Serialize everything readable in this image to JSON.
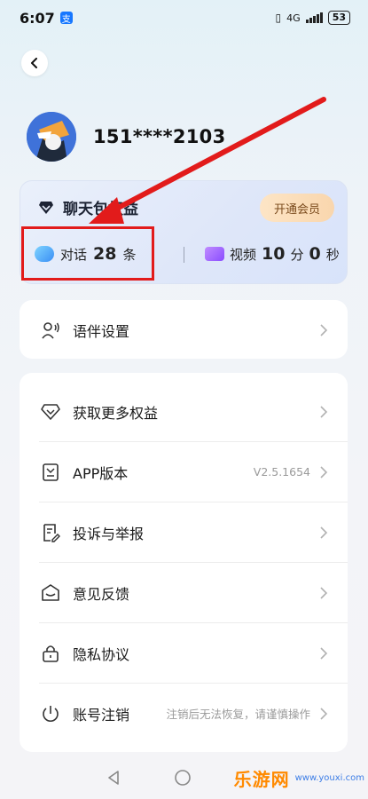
{
  "status_bar": {
    "time": "6:07",
    "app_badge_icon": "alipay-icon",
    "network": "4G",
    "battery": "53"
  },
  "profile": {
    "phone": "151****2103"
  },
  "benefit": {
    "title": "聊天包权益",
    "vip_button": "开通会员",
    "dialog_label": "对话",
    "dialog_count": "28",
    "dialog_unit": "条",
    "video_label": "视频",
    "video_minutes": "10",
    "video_minutes_unit": "分",
    "video_seconds": "0",
    "video_seconds_unit": "秒"
  },
  "settings": {
    "companion_label": "语伴设置"
  },
  "menu": {
    "items": [
      {
        "label": "获取更多权益",
        "value": "",
        "icon": "diamond-icon"
      },
      {
        "label": "APP版本",
        "value": "V2.5.1654",
        "icon": "version-icon"
      },
      {
        "label": "投诉与举报",
        "value": "",
        "icon": "report-icon"
      },
      {
        "label": "意见反馈",
        "value": "",
        "icon": "feedback-icon"
      },
      {
        "label": "隐私协议",
        "value": "",
        "icon": "lock-icon"
      },
      {
        "label": "账号注销",
        "value": "注销后无法恢复，请谨慎操作",
        "icon": "power-icon"
      }
    ]
  },
  "watermark": {
    "main": "乐游网",
    "sub": "www.youxi.com"
  },
  "colors": {
    "highlight": "#e21b1b",
    "vip_gradient_start": "#fde5c6",
    "accent_blue": "#3a8ef5",
    "video_purple": "#8a4dff"
  }
}
